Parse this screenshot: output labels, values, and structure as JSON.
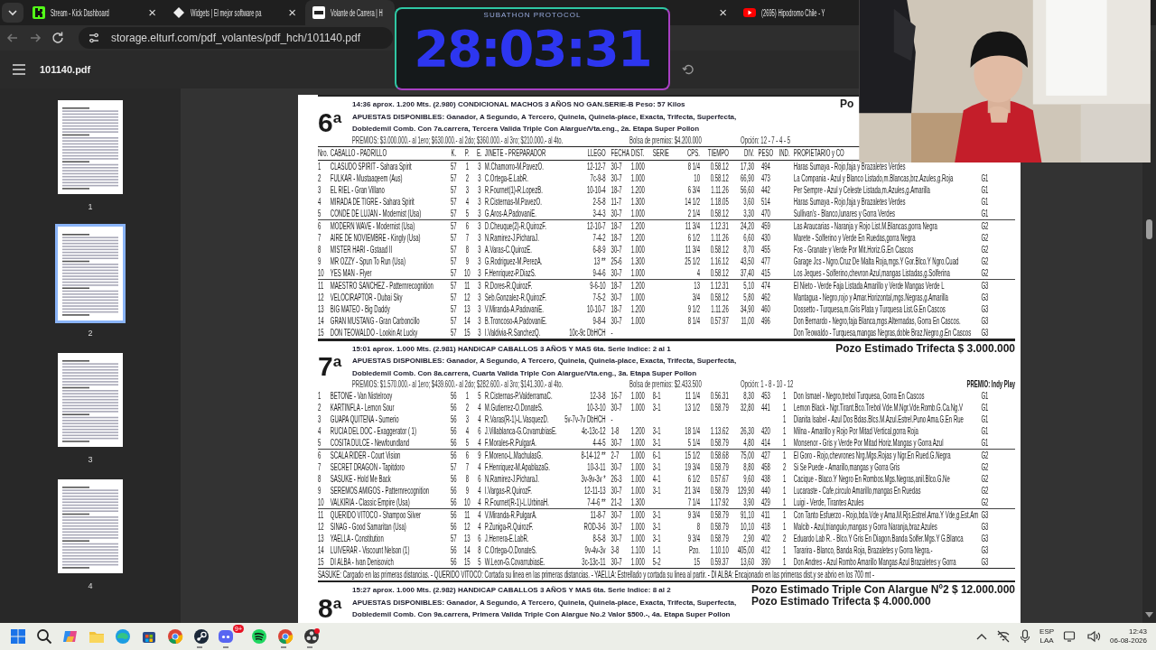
{
  "browser": {
    "tabs": [
      {
        "kind": "kick",
        "title": "Stream - Kick Dashboard",
        "selected": false,
        "close": "×"
      },
      {
        "kind": "widgets",
        "title": "Widgets | El mejor software pa",
        "selected": false,
        "close": "×"
      },
      {
        "kind": "volante",
        "title": "Volante de Carrera | H",
        "selected": true
      },
      {
        "kind": "blank",
        "selected": false,
        "close": "×"
      },
      {
        "kind": "youtube",
        "title": "(2695) Hipodromo Chile - Y",
        "selected": false
      }
    ],
    "url": "storage.elturf.com/pdf_volantes/pdf_hch/101140.pdf"
  },
  "pdf_viewer": {
    "file_name": "101140.pdf",
    "pages": [
      {
        "label": "1",
        "selected": false
      },
      {
        "label": "2",
        "selected": true
      },
      {
        "label": "3",
        "selected": false
      },
      {
        "label": "4",
        "selected": false
      }
    ]
  },
  "document": {
    "races": [
      {
        "number": "6$^{a}$",
        "lines": [
          "14:36 aprox. 1.200 Mts. (2.980) CONDICIONAL MACHOS 3 AÑOS NO GAN.SERIE-B Peso: 57 Kilos",
          "APUESTAS DISPONIBLES: Ganador, A Segundo, A Tercero, Quinela, Quinela-place, Exacta, Trifecta, Superfecta,",
          "Dobledemil Comb. Con 7a.carrera, Tercera Valida Triple Con Alargue/Vta.eng., 2a. Etapa Super Pollon"
        ],
        "pozo": [
          "Po"
        ],
        "prizes": "PREMIOS: $3.000.000.- al 1ero; $630.000.- al 2do; $360.000.- al 3ro; $210.000.- al 4to.",
        "bag": "Bolsa de premios: $4.200.000",
        "option": "Opción: 12 - 7 - 4 - 5",
        "columns": [
          "Nro.",
          "CABALLO - PADRILLO",
          "K.",
          "P.",
          "E.",
          "JINETE - PREPARADOR",
          "LLEGO",
          "FECHA",
          "DIST.",
          "SERIE",
          "CPS.",
          "TIEMPO",
          "DIV.",
          "PESO",
          "IND.",
          "PROPIETARIO y CO"
        ],
        "groups": [
          [
            {
              "n": "1",
              "horse": "CLASUDO SPIRIT - Sahara Spirit",
              "k": "57",
              "p": "1",
              "e": "3",
              "jockey": "M.Chamorro-M.PavezO.",
              "last": "12-12-7",
              "date": "30-7",
              "dist": "1.000",
              "cps": "8 1/4",
              "time": "0.58.12",
              "div": "17,30",
              "weight": "494",
              "owner": "Haras Sumaya - Rojo,faja y Brazaletes Verdes"
            },
            {
              "n": "2",
              "horse": "FULKAR - Mustaaqeem (Aus)",
              "k": "57",
              "p": "2",
              "e": "3",
              "jockey": "C.Ortega-E.LabR.",
              "last": "7c-9-8",
              "date": "30-7",
              "dist": "1.000",
              "cps": "10",
              "time": "0.58.12",
              "div": "66,90",
              "weight": "473",
              "owner": "La Compania - Azul y Blanco Listado,m.Blancas,brz.Azules,g.Roja",
              "group": "G1"
            },
            {
              "n": "3",
              "horse": "EL RIEL - Gran Villano",
              "k": "57",
              "p": "3",
              "e": "3",
              "jockey": "R.Fournet(1)-R.LopezB.",
              "last": "10-10-4",
              "date": "18-7",
              "dist": "1.200",
              "cps": "6 3/4",
              "time": "1.11.26",
              "div": "56,60",
              "weight": "442",
              "owner": "Per Sempre - Azul y Celeste Listada,m.Azules,g.Amarilla",
              "group": "G1"
            },
            {
              "n": "4",
              "horse": "MIRADA DE TIGRE - Sahara Spirit",
              "k": "57",
              "p": "4",
              "e": "3",
              "jockey": "R.Cisternas-M.PavezO.",
              "last": "2-5-8",
              "date": "11-7",
              "dist": "1.300",
              "cps": "14 1/2",
              "time": "1.18.05",
              "div": "3,60",
              "weight": "514",
              "owner": "Haras Sumaya - Rojo,faja y Brazaletes Verdes",
              "group": "G1"
            },
            {
              "n": "5",
              "horse": "CONDE DE LUJAN - Modernist (Usa)",
              "k": "57",
              "p": "5",
              "e": "3",
              "jockey": "G.Aros-A.PadovaniE.",
              "last": "3-4-3",
              "date": "30-7",
              "dist": "1.000",
              "cps": "2 1/4",
              "time": "0.58.12",
              "div": "3,30",
              "weight": "470",
              "owner": "Sullivan's - Blanco,lunares y Gorra Verdes",
              "group": "G1"
            }
          ],
          [
            {
              "n": "6",
              "horse": "MODERN WAVE - Modernist (Usa)",
              "k": "57",
              "p": "6",
              "e": "3",
              "jockey": "D.Cheuque(2)-R.QuirozF.",
              "last": "12-10-7",
              "date": "18-7",
              "dist": "1.200",
              "cps": "11 3/4",
              "time": "1.12.31",
              "div": "24,20",
              "weight": "459",
              "owner": "Las Araucarias - Naranja y Rojo List.M.Blancas,gorra Negra",
              "group": "G2"
            },
            {
              "n": "7",
              "horse": "AIRE DE NOVIEMBRE - Kingly (Usa)",
              "k": "57",
              "p": "7",
              "e": "3",
              "jockey": "N.Ramirez-J.PicharaJ.",
              "last": "7-4-2",
              "date": "18-7",
              "dist": "1.200",
              "cps": "6 1/2",
              "time": "1.11.26",
              "div": "6,60",
              "weight": "430",
              "owner": "Marete - Solferino y Verde En Ruedas,gorra Negra",
              "group": "G2"
            },
            {
              "n": "8",
              "horse": "MISTER HARI - Gstaad II",
              "k": "57",
              "p": "8",
              "e": "3",
              "jockey": "A.Varas-C.QuirozE.",
              "last": "6-8-9",
              "date": "30-7",
              "dist": "1.000",
              "cps": "11 3/4",
              "time": "0.58.12",
              "div": "8,70",
              "weight": "455",
              "owner": "Fos - Granate y Verde Por Mit.Horiz.G.En Cascos",
              "group": "G2"
            },
            {
              "n": "9",
              "horse": "MR OZZY - Spun To Run (Usa)",
              "k": "57",
              "p": "9",
              "e": "3",
              "jockey": "G.Rodriguez-M.PerezA.",
              "last": "13 **",
              "date": "25-6",
              "dist": "1.300",
              "cps": "25 1/2",
              "time": "1.16.12",
              "div": "43,50",
              "weight": "477",
              "owner": "Garage Jcs - Ngro.Cruz De Malta Roja,mgs.Y Gor.Blco.Y Ngro.Cuad",
              "group": "G2"
            },
            {
              "n": "10",
              "horse": "YES MAN - Flyer",
              "k": "57",
              "p": "10",
              "e": "3",
              "jockey": "F.Henriquez-P.DiazS.",
              "last": "9-4-6",
              "date": "30-7",
              "dist": "1.000",
              "cps": "4",
              "time": "0.58.12",
              "div": "37,40",
              "weight": "415",
              "owner": "Los Jeques - Solferino,chevron Azul,mangas Listadas,g.Solferina",
              "group": "G2"
            }
          ],
          [
            {
              "n": "11",
              "horse": "MAESTRO SANCHEZ - Patternrecognition",
              "k": "57",
              "p": "11",
              "e": "3",
              "jockey": "R.Dores-R.QuirozF.",
              "last": "9-6-10",
              "date": "18-7",
              "dist": "1.200",
              "cps": "13",
              "time": "1.12.31",
              "div": "5,10",
              "weight": "474",
              "owner": "El Nieto - Verde Faja Listada Amarillo y Verde Mangas Verde L",
              "group": "G3"
            },
            {
              "n": "12",
              "horse": "VELOCIRAPTOR - Dubai Sky",
              "k": "57",
              "p": "12",
              "e": "3",
              "jockey": "Seb.Gonzalez-R.QuirozF.",
              "last": "7-5-2",
              "date": "30-7",
              "dist": "1.000",
              "cps": "3/4",
              "time": "0.58.12",
              "div": "5,80",
              "weight": "462",
              "owner": "Mantagua - Negro,rojo y Amar.Horizontal,mgs.Negras,g.Amarilla",
              "group": "G3"
            },
            {
              "n": "13",
              "horse": "BIG MATEO - Big Daddy",
              "k": "57",
              "p": "13",
              "e": "3",
              "jockey": "V.Miranda-A.PadovaniE.",
              "last": "10-10-7",
              "date": "18-7",
              "dist": "1.200",
              "cps": "9 1/2",
              "time": "1.11.26",
              "div": "34,90",
              "weight": "460",
              "owner": "Dossetto - Turquesa,m.Gris Plata y Turquesa List.G.En Cascos",
              "group": "G3"
            },
            {
              "n": "14",
              "horse": "GRAN MUSTANG - Gran Carboncillo",
              "k": "57",
              "p": "14",
              "e": "3",
              "jockey": "B.Troncoso-A.PadovaniE.",
              "last": "9-8-4",
              "date": "30-7",
              "dist": "1.000",
              "cps": "8 1/4",
              "time": "0.57.97",
              "div": "11,00",
              "weight": "496",
              "owner": "Don Bernardo - Negro,faja Blanca,mgs.Alternadas, Gorra En Cascos.",
              "group": "G3"
            },
            {
              "n": "15",
              "horse": "DON TEOWALDO - Lookin At Lucky",
              "k": "57",
              "p": "15",
              "e": "3",
              "jockey": "I.Valdivia-R.SanchezQ.",
              "last": "10c-9c DbHCH",
              "date": "-",
              "owner": "Don Teowaldo - Turquesa,mangas Negras,doble Braz.Negro,g.En Cascos",
              "group": "G3"
            }
          ]
        ]
      },
      {
        "number": "7$^{a}$",
        "lines": [
          "15:01 aprox. 1.000 Mts. (2.981) HANDICAP CABALLOS 3 AÑOS Y MAS 6ta. Serie Indice: 2 al 1",
          "APUESTAS DISPONIBLES: Ganador, A Segundo, A Tercero, Quinela, Quinela-place, Exacta, Trifecta, Superfecta,",
          "Dobledemil Comb. Con 8a.carrera, Cuarta Valida Triple Con Alargue/Vta.eng., 3a. Etapa Super Pollon"
        ],
        "pozo": [
          "Pozo Estimado Trifecta $ 3.000.000"
        ],
        "prizes": "PREMIOS: $1.570.000.- al 1ero; $439.600.- al 2do; $282.600.- al 3ro; $141.300.- al 4to.",
        "bag": "Bolsa de premios: $2.433.500",
        "option": "Opción: 1 - 8 - 10 - 12",
        "sponsor": "PREMIO: Indy Play",
        "groups": [
          [
            {
              "n": "1",
              "horse": "BETONE - Van Nistelrooy",
              "k": "56",
              "p": "1",
              "e": "5",
              "jockey": "R.Cisternas-P.ValderramaC.",
              "last": "12-3-8",
              "date": "16-7",
              "dist": "1.000",
              "series": "8-1",
              "cps": "11 1/4",
              "time": "0.56.31",
              "div": "8,30",
              "weight": "453",
              "ind": "1",
              "owner": "Don Ismael - Negro,trebol Turquesa, Gorra En Cascos",
              "group": "G1"
            },
            {
              "n": "2",
              "horse": "KARTINFLA - Lemon Sour",
              "k": "56",
              "p": "2",
              "e": "4",
              "jockey": "M.Gutierrez-O.DonateS.",
              "last": "10-3-10",
              "date": "30-7",
              "dist": "1.000",
              "series": "3-1",
              "cps": "13 1/2",
              "time": "0.58.79",
              "div": "32,80",
              "weight": "441",
              "ind": "1",
              "owner": "Lemon Black - Ngr.Tirant.Bco.Trebol Vde.M.Ngr.Vde.Romb.G.Ca.Ng.V",
              "group": "G1"
            },
            {
              "n": "3",
              "horse": "GUAPA QUITENA - Sumerio",
              "k": "56",
              "p": "3",
              "e": "4",
              "jockey": "R.Varas(R-1)-L.VasquezD.",
              "last": "5v-7v-7v DbHCH",
              "date": "-",
              "ind": "1",
              "owner": "Dianita Isabel - Azul Dos Bdas.Blcs.M.Azul.Estrel.Puno Ama.G.En Rue",
              "group": "G1"
            },
            {
              "n": "4",
              "horse": "RUCIA DEL DOC - Exaggerator ( 1)",
              "k": "56",
              "p": "4",
              "e": "6",
              "jockey": "J.Villablanca-G.CovarrubiasE.",
              "last": "4c-13c-12",
              "date": "1-8",
              "dist": "1.200",
              "series": "3-1",
              "cps": "18 1/4",
              "time": "1.13.62",
              "div": "26,30",
              "weight": "420",
              "ind": "1",
              "owner": "Milna - Amarillo y Rojo Por Mitad Vertical,gorra Roja",
              "group": "G1"
            },
            {
              "n": "5",
              "horse": "COSITA DULCE - Newfoundland",
              "k": "56",
              "p": "5",
              "e": "4",
              "jockey": "F.Morales-R.PulgarA.",
              "last": "4-4-5",
              "date": "30-7",
              "dist": "1.000",
              "series": "3-1",
              "cps": "5 1/4",
              "time": "0.58.79",
              "div": "4,80",
              "weight": "414",
              "ind": "1",
              "owner": "Monsenor - Gris y Verde Por Mitad Horiz.Mangas y Gorra Azul",
              "group": "G1"
            }
          ],
          [
            {
              "n": "6",
              "horse": "SCALA RIDER - Court Vision",
              "k": "56",
              "p": "6",
              "e": "9",
              "jockey": "F.Moreno-L.MachulasG.",
              "last": "8-14-12 **",
              "date": "2-7",
              "dist": "1.000",
              "series": "6-1",
              "cps": "15 1/2",
              "time": "0.58.68",
              "div": "75,00",
              "weight": "427",
              "ind": "1",
              "owner": "El Goro - Rojo,chevrones Nrg.Mgs.Rojas y Ngr.En Rued.G.Negra",
              "group": "G2"
            },
            {
              "n": "7",
              "horse": "SECRET DRAGON - Tapitdoro",
              "k": "57",
              "p": "7",
              "e": "4",
              "jockey": "F.Henriquez-M.ApablazaG.",
              "last": "10-3-11",
              "date": "30-7",
              "dist": "1.000",
              "series": "3-1",
              "cps": "19 3/4",
              "time": "0.58.79",
              "div": "8,80",
              "weight": "458",
              "ind": "2",
              "owner": "Si Se Puede - Amarillo,mangas y Gorra Gris",
              "group": "G2"
            },
            {
              "n": "8",
              "horse": "SASUKE - Hold Me Back",
              "k": "56",
              "p": "8",
              "e": "6",
              "jockey": "N.Ramirez-J.PicharaJ.",
              "last": "3v-9v-3v *",
              "date": "26-3",
              "dist": "1.000",
              "series": "4-1",
              "cps": "6 1/2",
              "time": "0.57.67",
              "div": "9,60",
              "weight": "438",
              "ind": "1",
              "owner": "Cacique - Blaco.Y Negro En Rombos.Mgs.Negras,anil.Blco.G.Ne",
              "group": "G2"
            },
            {
              "n": "9",
              "horse": "SEREMOS AMIGOS - Patternrecognition",
              "k": "56",
              "p": "9",
              "e": "4",
              "jockey": "I.Vargas-R.QuirozF.",
              "last": "12-11-13",
              "date": "30-7",
              "dist": "1.000",
              "series": "3-1",
              "cps": "21 3/4",
              "time": "0.58.79",
              "div": "129,90",
              "weight": "440",
              "ind": "1",
              "owner": "Lucaraste - Cafe,circulo Amarillo,mangas En Ruedas",
              "group": "G2"
            },
            {
              "n": "10",
              "horse": "VALKIRIA - Classic Empire (Usa)",
              "k": "56",
              "p": "10",
              "e": "4",
              "jockey": "R.Fournet(R-1)-L.UrbinaH.",
              "last": "7-4-6 **",
              "date": "21-2",
              "dist": "1.300",
              "cps": "7 1/4",
              "time": "1.17.92",
              "div": "3,90",
              "weight": "429",
              "ind": "1",
              "owner": "Luigi - Verde, Tirantes Azules",
              "group": "G2"
            }
          ],
          [
            {
              "n": "11",
              "horse": "QUERIDO VITOCO - Shampoo Silver",
              "k": "56",
              "p": "11",
              "e": "4",
              "jockey": "V.Miranda-R.PulgarA.",
              "last": "11-8-7",
              "date": "30-7",
              "dist": "1.000",
              "series": "3-1",
              "cps": "9 3/4",
              "time": "0.58.79",
              "div": "91,10",
              "weight": "411",
              "ind": "1",
              "owner": "Con Tanto Esfuerzo - Rojo,bda.Vde y Ama.M.Rjs.Estrel.Ama.Y Vde,g.Est.Am",
              "group": "G3"
            },
            {
              "n": "12",
              "horse": "SINAG - Good Samaritan (Usa)",
              "k": "56",
              "p": "12",
              "e": "4",
              "jockey": "P.Zuniga-R.QuirozF.",
              "last": "ROD-3-6",
              "date": "30-7",
              "dist": "1.000",
              "series": "3-1",
              "cps": "8",
              "time": "0.58.79",
              "div": "10,10",
              "weight": "418",
              "ind": "1",
              "owner": "Malcib - Azul,triangulo,mangas y Gorra Naranja,braz.Azules",
              "group": "G3"
            },
            {
              "n": "13",
              "horse": "YAELLA - Constitution",
              "k": "57",
              "p": "13",
              "e": "6",
              "jockey": "J.Herrera-E.LabR.",
              "last": "8-5-8",
              "date": "30-7",
              "dist": "1.000",
              "series": "3-1",
              "cps": "9 3/4",
              "time": "0.58.79",
              "div": "2,90",
              "weight": "402",
              "ind": "2",
              "owner": "Eduardo Lab R. - Blco.Y Gris En Diagon.Banda Solfer.Mgs.Y G.Blanca",
              "group": "G3"
            },
            {
              "n": "14",
              "horse": "LUIVERAR - Viscount Nelson (1)",
              "k": "56",
              "p": "14",
              "e": "8",
              "jockey": "C.Ortega-O.DonateS.",
              "last": "9v-4v-3v",
              "date": "3-8",
              "dist": "1.100",
              "series": "1-1",
              "cps": "Pzo.",
              "time": "1.10.10",
              "div": "405,00",
              "weight": "412",
              "ind": "1",
              "owner": "Tararira - Blanco, Banda Roja, Brazaletes y Gorra Negra.-",
              "group": "G3"
            },
            {
              "n": "15",
              "horse": "DI ALBA - Ivan Denisovich",
              "k": "56",
              "p": "15",
              "e": "5",
              "jockey": "W.Leon-G.CovarrubiasE.",
              "last": "3c-13c-11",
              "date": "30-7",
              "dist": "1.000",
              "series": "5-2",
              "cps": "15",
              "time": "0.59.37",
              "div": "13,60",
              "weight": "390",
              "ind": "1",
              "owner": "Don Andres - Azul Rombo Amarillo Mangas Azul Brazaletes y Gorra",
              "group": "G3"
            }
          ]
        ],
        "note": "SASUKE: Cargado en las primeras distancias. - QUERIDO VITOCO: Cortada su linea en las primeras distancias. - YAELLA: Estrellado y cortada su linea al partir. - DI ALBA: Encajonado en las primeras dist.y se abrio en los 700 mt -"
      },
      {
        "number": "8$^{a}$",
        "lines": [
          "15:27 aprox. 1.000 Mts. (2.982) HANDICAP CABALLOS 3 AÑOS Y MAS 6ta. Serie Indice: 8 al 2",
          "APUESTAS DISPONIBLES: Ganador, A Segundo, A Tercero, Quinela, Quinela-place, Exacta, Trifecta, Superfecta,",
          "Dobledemil Comb. Con 9a.carrera, Primera Valida Triple Con Alargue No.2 Valor $500.-, 4a. Etapa Super Pollon"
        ],
        "pozo": [
          "Pozo Estimado Triple Con Alargue Nº2 $ 12.000.000",
          "Pozo Estimado Trifecta $ 4.000.000"
        ]
      }
    ]
  },
  "timer_overlay": {
    "caption": "SUBATHON PROTOCOL",
    "time": "28:03:31"
  },
  "taskbar": {
    "apps": [
      {
        "kind": "start",
        "running": false
      },
      {
        "kind": "search",
        "running": false
      },
      {
        "kind": "copilot",
        "running": false
      },
      {
        "kind": "files",
        "running": false
      },
      {
        "kind": "edge",
        "running": false
      },
      {
        "kind": "store",
        "running": false
      },
      {
        "kind": "chrome",
        "running": false
      },
      {
        "kind": "steam",
        "running": true
      },
      {
        "kind": "discord",
        "running": true,
        "badge": "9+"
      },
      {
        "kind": "spotify",
        "running": false
      },
      {
        "kind": "chrome",
        "running": true
      },
      {
        "kind": "obs",
        "running": true
      }
    ],
    "language": "ESP",
    "layout": "LAA",
    "time": "12:43",
    "date": "06-08-2026"
  }
}
